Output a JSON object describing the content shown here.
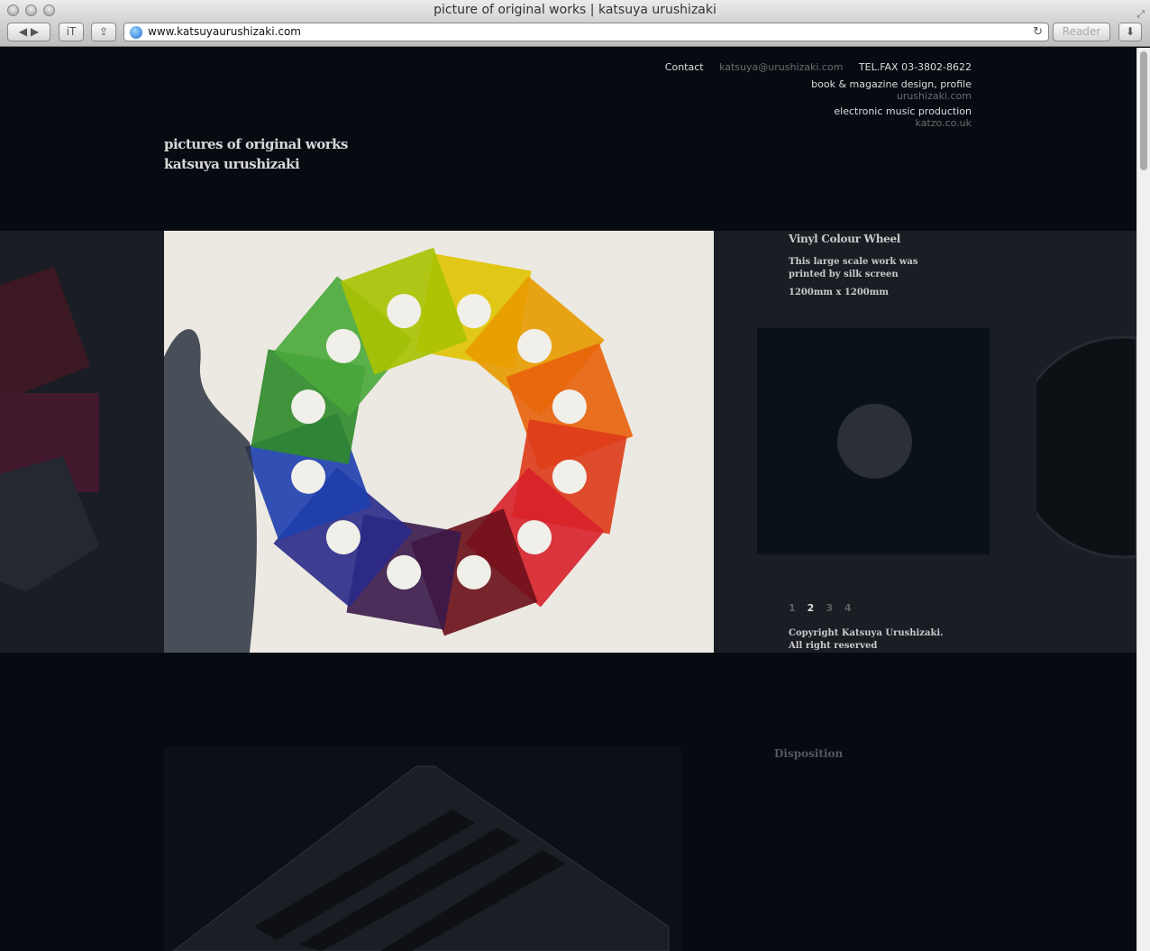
{
  "window": {
    "title": "picture of original works | katsuya urushizaki",
    "url": "www.katsuyaurushizaki.com",
    "reader_label": "Reader"
  },
  "header": {
    "contact_label": "Contact",
    "email": "katsuya@urushizaki.com",
    "tel": "TEL.FAX  03-3802-8622",
    "design_label": "book & magazine design, profile",
    "design_link": "urushizaki.com",
    "music_label": "electronic music production",
    "music_link": "katzo.co.uk"
  },
  "site_title": {
    "line1": "pictures of original works",
    "line2": "katsuya urushizaki"
  },
  "work": {
    "title": "Vinyl Colour Wheel",
    "description": "This large scale work was printed by silk screen",
    "size": "1200mm x 1200mm",
    "pages": [
      "1",
      "2",
      "3",
      "4"
    ],
    "current_page": "2"
  },
  "copyright": {
    "line1": "Copyright Katsuya Urushizaki.",
    "line2": "All right reserved"
  },
  "next_work": {
    "title": "Disposition"
  },
  "colors": {
    "wheel": [
      "#e0c400",
      "#e89a00",
      "#e8620a",
      "#de3a1a",
      "#d8202a",
      "#6a0f18",
      "#3a1a4a",
      "#2a2a8a",
      "#1e3fae",
      "#2f8a2a",
      "#49a83a",
      "#a9c200"
    ]
  }
}
